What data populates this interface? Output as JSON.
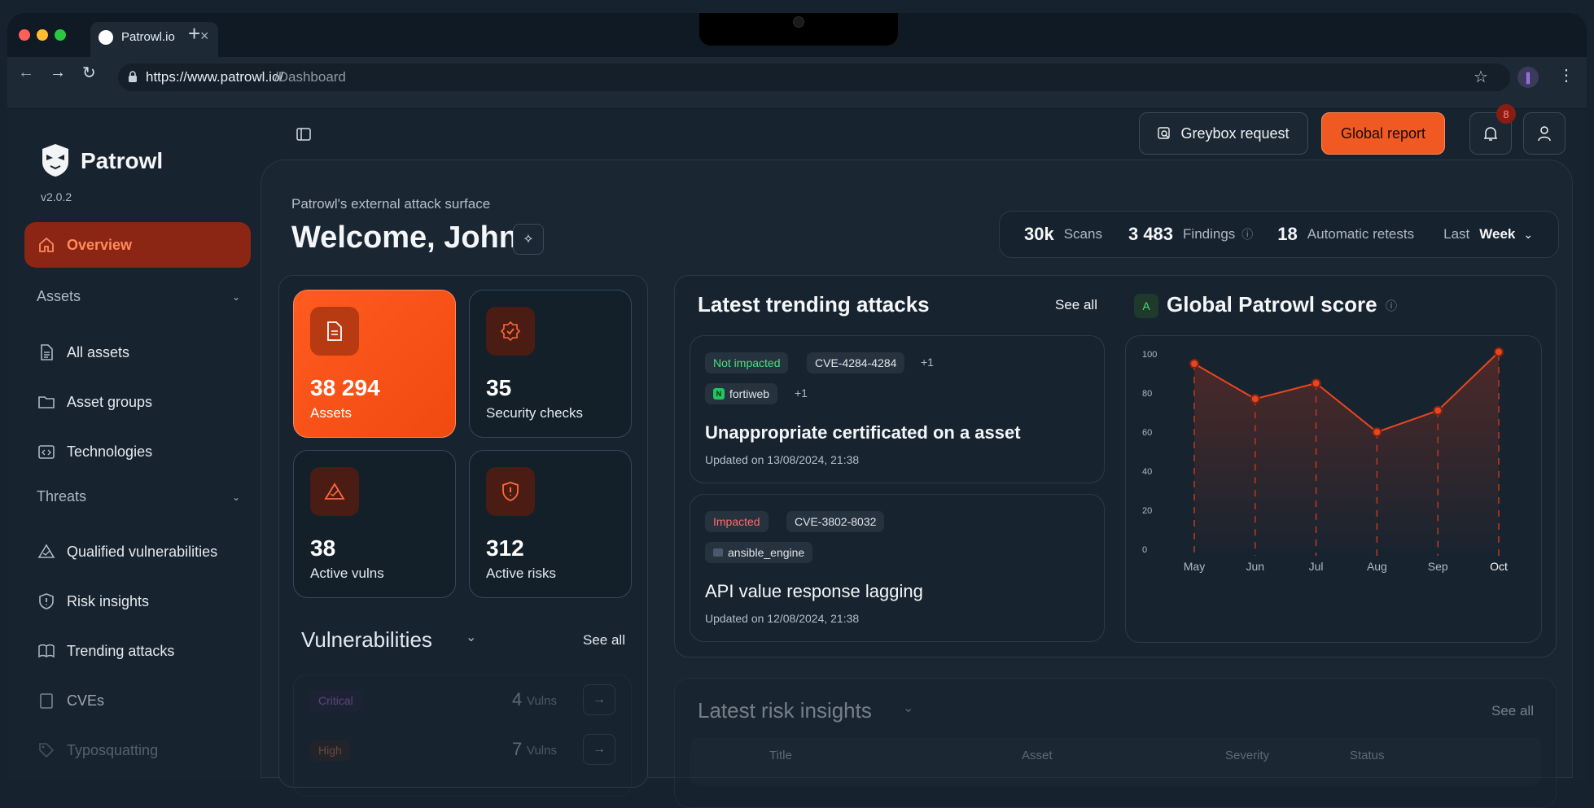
{
  "browser": {
    "tab_title": "Patrowl.io",
    "url_host": "https://www.patrowl.io/",
    "url_path": "/Dashboard"
  },
  "sidebar": {
    "logo": "Patrowl",
    "version": "v2.0.2",
    "overview": "Overview",
    "assets_section": "Assets",
    "assets_items": [
      "All assets",
      "Asset groups",
      "Technologies"
    ],
    "threats_section": "Threats",
    "threats_items": [
      "Qualified vulnerabilities",
      "Risk insights",
      "Trending attacks",
      "CVEs",
      "Typosquatting"
    ]
  },
  "header": {
    "greybox": "Greybox request",
    "global_report": "Global report",
    "notifications_count": "8"
  },
  "welcome": {
    "subtitle": "Patrowl's external attack surface",
    "title": "Welcome, John"
  },
  "summary": {
    "scans_value": "30k",
    "scans_label": "Scans",
    "findings_value": "3 483",
    "findings_label": "Findings",
    "retests_value": "18",
    "retests_label": "Automatic retests",
    "period_label": "Last",
    "period_value": "Week"
  },
  "stats": [
    {
      "value": "38 294",
      "label": "Assets"
    },
    {
      "value": "35",
      "label": "Security checks"
    },
    {
      "value": "38",
      "label": "Active vulns"
    },
    {
      "value": "312",
      "label": "Active risks"
    }
  ],
  "vulnerabilities": {
    "title": "Vulnerabilities",
    "see_all": "See all",
    "rows": [
      {
        "severity": "Critical",
        "count": "4",
        "unit": "Vulns"
      },
      {
        "severity": "High",
        "count": "7",
        "unit": "Vulns"
      }
    ]
  },
  "trending": {
    "title": "Latest trending attacks",
    "see_all": "See all",
    "items": [
      {
        "status": "Not impacted",
        "cve": "CVE-4284-4284",
        "cve_more": "+1",
        "tech": "fortiweb",
        "tech_more": "+1",
        "title": "Unappropriate certificated on a asset",
        "updated": "Updated on 13/08/2024, 21:38"
      },
      {
        "status": "Impacted",
        "cve": "CVE-3802-8032",
        "tech": "ansible_engine",
        "title": "API value response lagging",
        "updated": "Updated on 12/08/2024, 21:38"
      }
    ]
  },
  "score": {
    "grade": "A",
    "title": "Global Patrowl score"
  },
  "chart_data": {
    "type": "area",
    "categories": [
      "May",
      "Jun",
      "Jul",
      "Aug",
      "Sep",
      "Oct"
    ],
    "values": [
      95,
      77,
      85,
      60,
      71,
      101
    ],
    "ylim": [
      0,
      100
    ],
    "yticks": [
      "100",
      "80",
      "60",
      "40",
      "20",
      "0"
    ],
    "color": "#e8461e"
  },
  "risk_insights": {
    "title": "Latest risk insights",
    "see_all": "See all",
    "columns": [
      "Title",
      "Asset",
      "Severity",
      "Status"
    ]
  },
  "colors": {
    "accent": "#f05a22",
    "impacted": "#ff6b6b",
    "not_impacted": "#4ade80"
  }
}
